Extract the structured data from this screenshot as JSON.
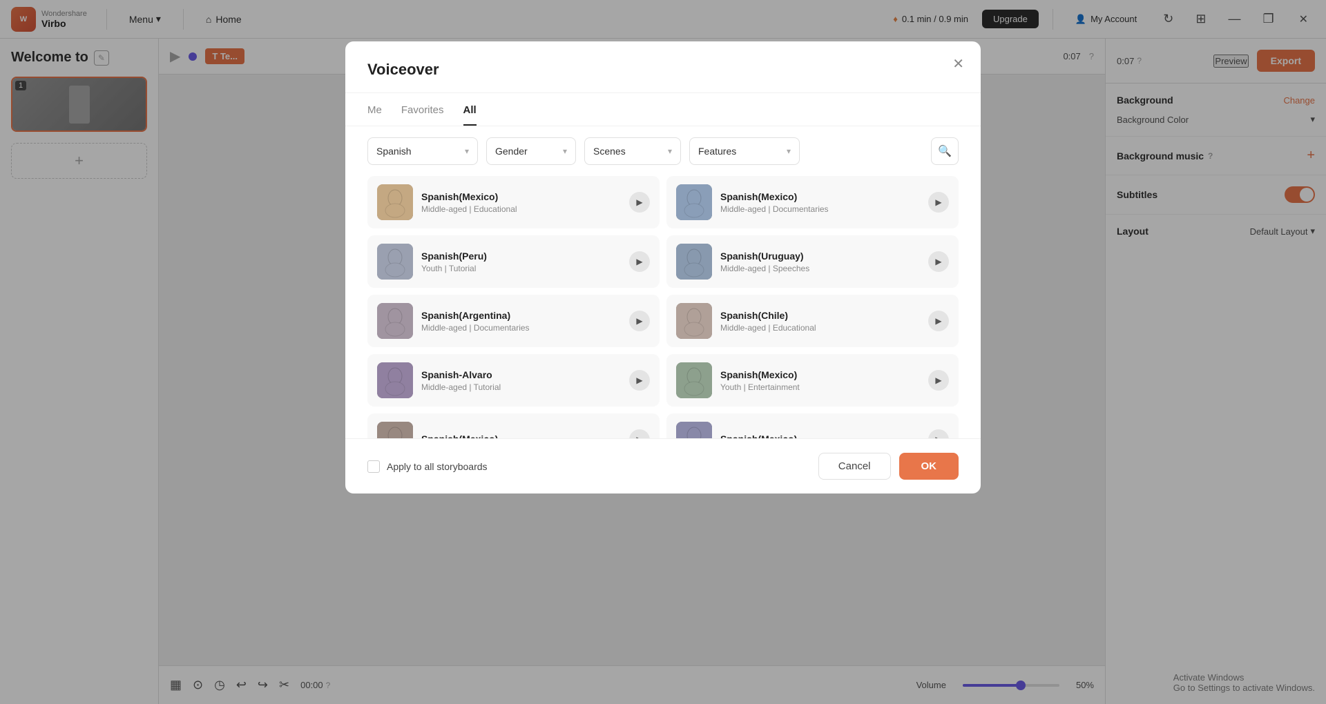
{
  "titlebar": {
    "logo_letter": "W",
    "logo_brand": "Wondershare",
    "logo_product": "Virbo",
    "menu_label": "Menu",
    "home_label": "Home",
    "credits_display": "0.1 min / 0.9 min",
    "upgrade_label": "Upgrade",
    "account_label": "My Account",
    "minimize_icon": "—",
    "restore_icon": "❐",
    "close_icon": "✕"
  },
  "editor": {
    "welcome_text": "Welcome to",
    "scene_number": "1",
    "preview_label": "Preview",
    "export_label": "Export",
    "time_display": "0:07",
    "help_icon": "?",
    "play_icon": "▶",
    "undo_icon": "↩",
    "redo_icon": "↪",
    "brush_icon": "🖌",
    "clock_icon": "🕐",
    "scissors_icon": "✂",
    "time_code": "00:00",
    "time_help": "?",
    "volume_label": "Volume",
    "volume_percent": "50%",
    "activate_windows": "Activate Windows",
    "go_to_settings": "Go to Settings to activate Windows."
  },
  "right_panel": {
    "background_label": "Background",
    "change_label": "Change",
    "bg_color_label": "Background Color",
    "bg_color_value": "▼",
    "music_label": "Background music",
    "music_help": "?",
    "subtitles_label": "Subtitles",
    "layout_label": "Layout",
    "layout_value": "Default Layout"
  },
  "modal": {
    "title": "Voiceover",
    "close_icon": "✕",
    "tabs": [
      {
        "label": "Me",
        "active": false
      },
      {
        "label": "Favorites",
        "active": false
      },
      {
        "label": "All",
        "active": true
      }
    ],
    "filters": {
      "language": "Spanish",
      "gender": "Gender",
      "scenes": "Scenes",
      "features": "Features"
    },
    "voices": [
      {
        "id": 1,
        "name": "Spanish(Mexico)",
        "meta": "Middle-aged | Educational",
        "avatar_class": "av1"
      },
      {
        "id": 2,
        "name": "Spanish(Mexico)",
        "meta": "Middle-aged | Documentaries",
        "avatar_class": "av2"
      },
      {
        "id": 3,
        "name": "Spanish(Peru)",
        "meta": "Youth | Tutorial",
        "avatar_class": "av3"
      },
      {
        "id": 4,
        "name": "Spanish(Uruguay)",
        "meta": "Middle-aged | Speeches",
        "avatar_class": "av4"
      },
      {
        "id": 5,
        "name": "Spanish(Argentina)",
        "meta": "Middle-aged | Documentaries",
        "avatar_class": "av5"
      },
      {
        "id": 6,
        "name": "Spanish(Chile)",
        "meta": "Middle-aged | Educational",
        "avatar_class": "av6"
      },
      {
        "id": 7,
        "name": "Spanish-Alvaro",
        "meta": "Middle-aged | Tutorial",
        "avatar_class": "av7"
      },
      {
        "id": 8,
        "name": "Spanish(Mexico)",
        "meta": "Youth | Entertainment",
        "avatar_class": "av8"
      },
      {
        "id": 9,
        "name": "Spanish(Mexico)",
        "meta": "",
        "avatar_class": "av9"
      },
      {
        "id": 10,
        "name": "Spanish(Mexico)",
        "meta": "",
        "avatar_class": "av10"
      }
    ],
    "apply_label": "Apply to all storyboards",
    "cancel_label": "Cancel",
    "ok_label": "OK"
  }
}
